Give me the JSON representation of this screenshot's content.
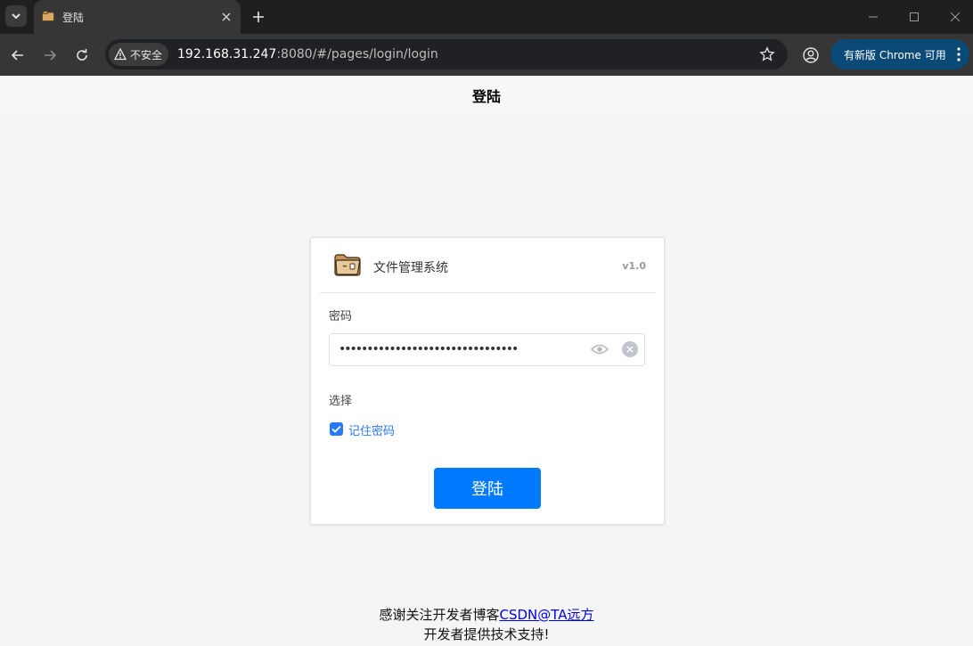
{
  "browser": {
    "tab_title": "登陆",
    "security_label": "不安全",
    "url_host": "192.168.31.247",
    "url_rest": ":8080/#/pages/login/login",
    "update_label": "有新版 Chrome 可用"
  },
  "page": {
    "header_title": "登陆"
  },
  "card": {
    "title": "文件管理系统",
    "version": "v1.0",
    "password_label": "密码",
    "password_value": "••••••••••••••••••••••••••••••••",
    "options_label": "选择",
    "remember_label": "记住密码",
    "remember_checked": true,
    "login_button": "登陆"
  },
  "footer": {
    "line1_prefix": "感谢关注开发者博客",
    "line1_link": "CSDN@TA远方",
    "line2": "开发者提供技术支持!"
  },
  "colors": {
    "primary": "#007aff",
    "checkbox": "#2979ff",
    "link": "#0000ee"
  }
}
